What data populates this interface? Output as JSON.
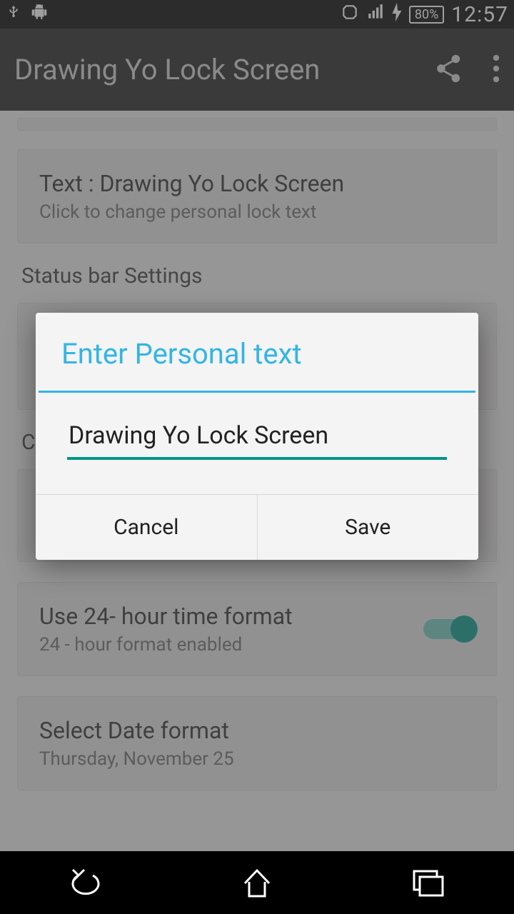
{
  "status": {
    "battery": "80%",
    "time": "12:57"
  },
  "appbar": {
    "title": "Drawing Yo Lock Screen"
  },
  "cards": {
    "text_row_title": "Text : Drawing Yo Lock Screen",
    "text_row_sub": "Click to change personal lock text",
    "section_status": "Status bar Settings",
    "clock_partial": "Cl",
    "time_row_title": "Use 24- hour time format",
    "time_row_sub": "24 - hour format enabled",
    "date_row_title": "Select Date format",
    "date_row_sub": "Thursday, November 25"
  },
  "dialog": {
    "title": "Enter Personal text",
    "input_value": "Drawing Yo Lock Screen",
    "cancel": "Cancel",
    "save": "Save"
  }
}
